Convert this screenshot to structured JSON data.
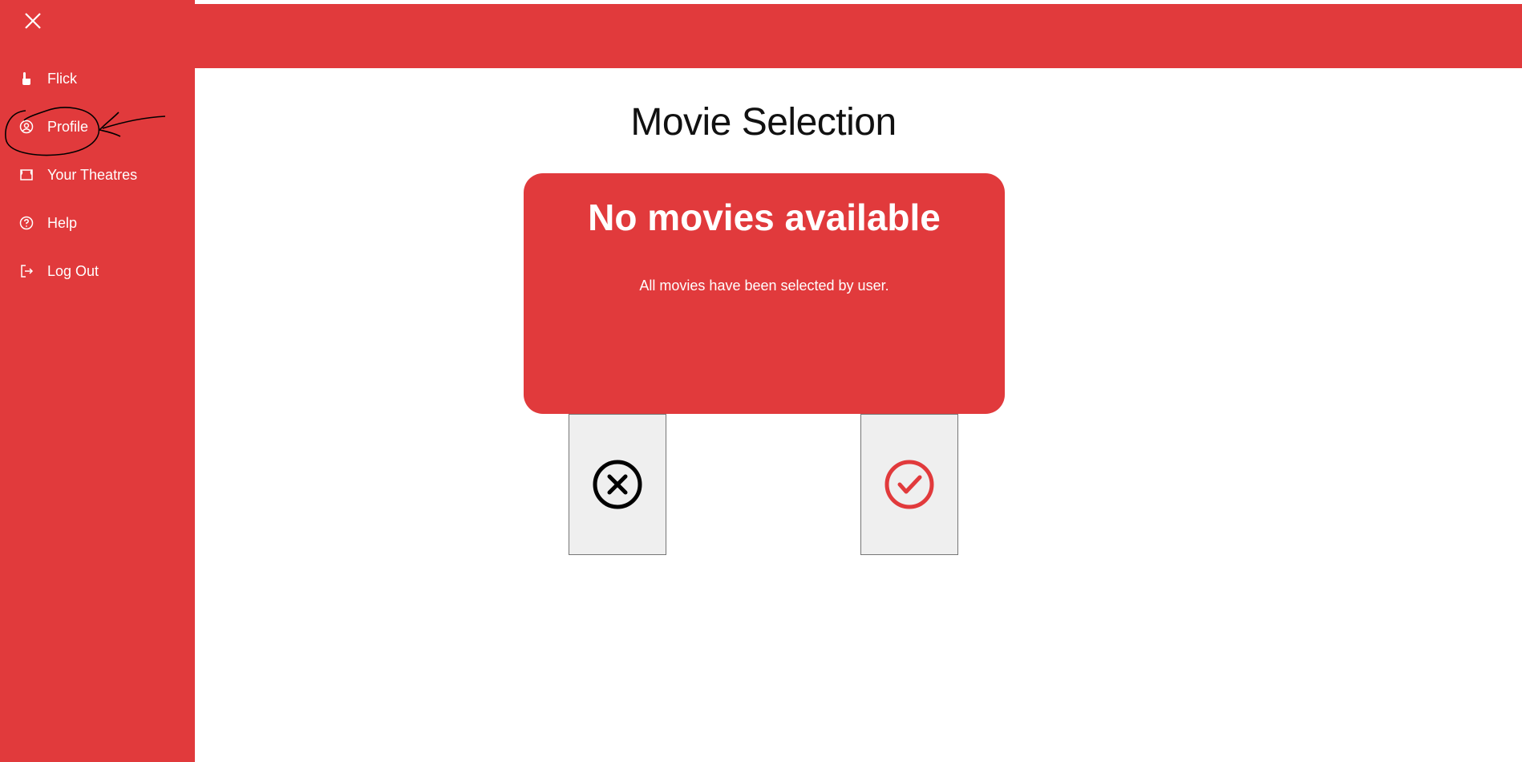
{
  "sidebar": {
    "close_label": "close",
    "items": [
      {
        "label": "Flick",
        "icon": "pointer-hand-icon"
      },
      {
        "label": "Profile",
        "icon": "user-circle-icon"
      },
      {
        "label": "Your Theatres",
        "icon": "theatre-icon"
      },
      {
        "label": "Help",
        "icon": "help-circle-icon"
      },
      {
        "label": "Log Out",
        "icon": "logout-icon"
      }
    ]
  },
  "main": {
    "title": "Movie Selection",
    "card": {
      "heading": "No movies available",
      "message": "All movies have been selected by user."
    },
    "reject_button_icon": "x-circle-icon",
    "accept_button_icon": "check-circle-icon"
  },
  "colors": {
    "brand_red": "#e13a3c",
    "background": "#ffffff",
    "button_bg": "#efefef"
  }
}
